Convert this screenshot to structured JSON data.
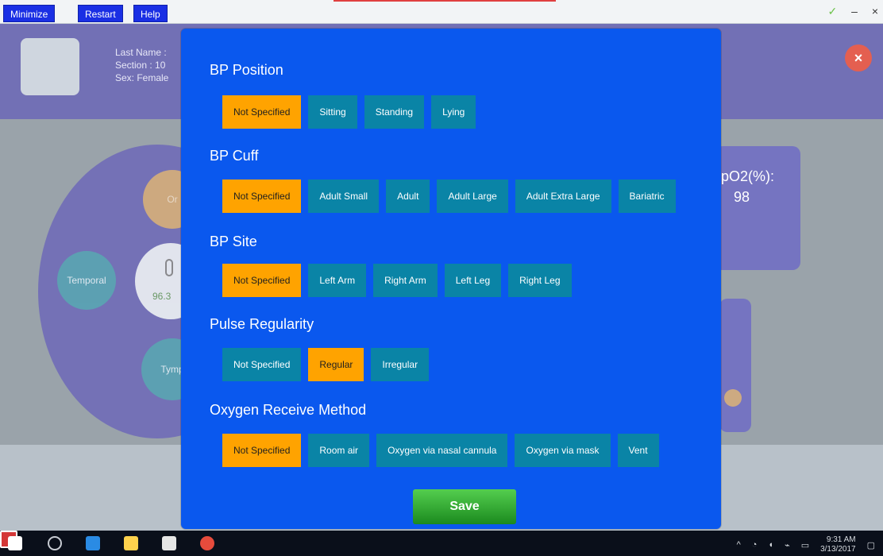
{
  "titlebar": {
    "buttons": [
      "Minimize",
      "Restart",
      "Help"
    ],
    "window_controls": [
      "✓",
      "–",
      "×"
    ]
  },
  "background": {
    "patient": {
      "last_name": "Last Name :",
      "section": "Section : 10",
      "sex": "Sex: Female"
    },
    "spo2_title": "pO2(%):",
    "spo2_value": "98",
    "circles": {
      "or": "Or",
      "temporal": "Temporal",
      "center_value": "96.3",
      "tymp": "Tymp"
    }
  },
  "modal": {
    "sections": [
      {
        "title": "BP Position",
        "options": [
          "Not Specified",
          "Sitting",
          "Standing",
          "Lying"
        ],
        "selected_index": 0
      },
      {
        "title": "BP Cuff",
        "options": [
          "Not Specified",
          "Adult Small",
          "Adult",
          "Adult Large",
          "Adult Extra Large",
          "Bariatric"
        ],
        "selected_index": 0
      },
      {
        "title": "BP Site",
        "options": [
          "Not Specified",
          "Left Arm",
          "Right Arm",
          "Left Leg",
          "Right Leg"
        ],
        "selected_index": 0
      },
      {
        "title": "Pulse Regularity",
        "options": [
          "Not Specified",
          "Regular",
          "Irregular"
        ],
        "selected_index": 1
      },
      {
        "title": "Oxygen Receive Method",
        "options": [
          "Not Specified",
          "Room air",
          "Oxygen via nasal cannula",
          "Oxygen via mask",
          "Vent"
        ],
        "selected_index": 0
      }
    ],
    "save_label": "Save"
  },
  "taskbar": {
    "time": "9:31 AM",
    "date": "3/13/2017"
  },
  "colors": {
    "modal_bg": "#0a58ee",
    "option_bg": "#0a84a6",
    "option_selected_bg": "#ffa300",
    "save_green": "#2aa52a",
    "titlebar_btn": "#1a2fe4"
  }
}
